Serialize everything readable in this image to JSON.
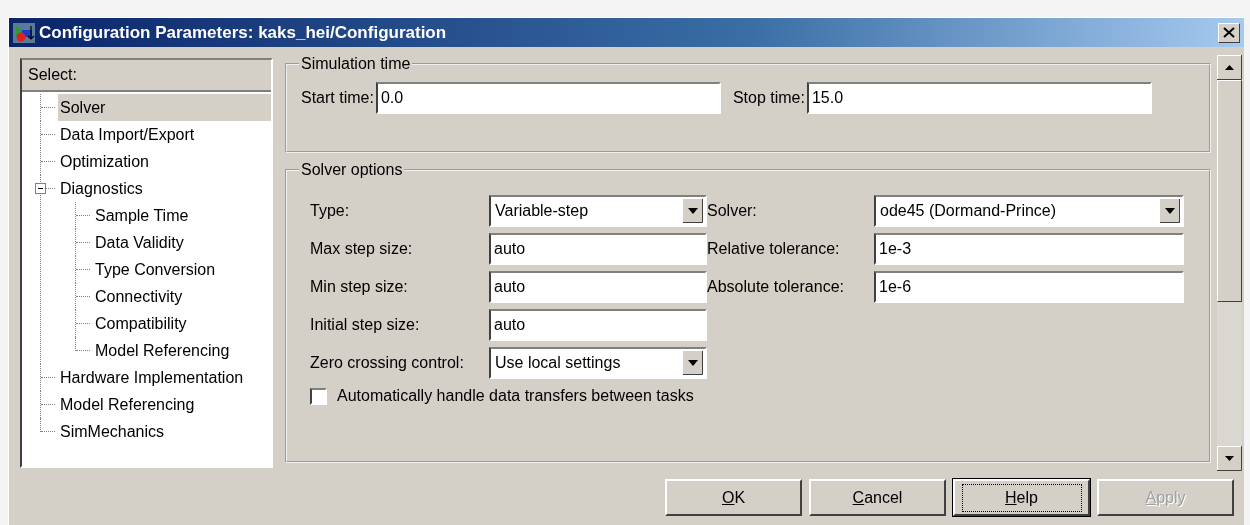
{
  "window": {
    "title": "Configuration Parameters: kaks_hei/Configuration"
  },
  "tree": {
    "header": "Select:",
    "items": [
      {
        "label": "Solver",
        "selected": true
      },
      {
        "label": "Data Import/Export",
        "selected": false
      },
      {
        "label": "Optimization",
        "selected": false
      },
      {
        "label": "Diagnostics",
        "selected": false,
        "expanded": true,
        "children": [
          {
            "label": "Sample Time",
            "selected": false
          },
          {
            "label": "Data Validity",
            "selected": false
          },
          {
            "label": "Type Conversion",
            "selected": false
          },
          {
            "label": "Connectivity",
            "selected": false
          },
          {
            "label": "Compatibility",
            "selected": false
          },
          {
            "label": "Model Referencing",
            "selected": false
          }
        ]
      },
      {
        "label": "Hardware Implementation",
        "selected": false
      },
      {
        "label": "Model Referencing",
        "selected": false
      },
      {
        "label": "SimMechanics",
        "selected": false
      }
    ]
  },
  "simulation_time": {
    "title": "Simulation time",
    "fields": [
      {
        "label": "Start time:",
        "value": "0.0"
      },
      {
        "label": "Stop time:",
        "value": "15.0"
      }
    ]
  },
  "solver_options": {
    "title": "Solver options",
    "rows": [
      {
        "left": {
          "kind": "dropdown",
          "label": "Type:",
          "value": "Variable-step"
        },
        "right": {
          "kind": "dropdown",
          "label": "Solver:",
          "value": "ode45 (Dormand-Prince)"
        }
      },
      {
        "left": {
          "kind": "text",
          "label": "Max step size:",
          "value": "auto"
        },
        "right": {
          "kind": "text",
          "label": "Relative tolerance:",
          "value": "1e-3"
        }
      },
      {
        "left": {
          "kind": "text",
          "label": "Min step size:",
          "value": "auto"
        },
        "right": {
          "kind": "text",
          "label": "Absolute tolerance:",
          "value": "1e-6"
        }
      },
      {
        "left": {
          "kind": "text",
          "label": "Initial step size:",
          "value": "auto"
        }
      },
      {
        "left": {
          "kind": "dropdown",
          "label": "Zero crossing control:",
          "value": "Use local settings"
        }
      }
    ],
    "checkbox": {
      "label": "Automatically handle data transfers between tasks",
      "checked": false
    }
  },
  "buttons": [
    {
      "label": "OK",
      "disabled": false,
      "focused": false
    },
    {
      "label": "Cancel",
      "disabled": false,
      "focused": false
    },
    {
      "label": "Help",
      "disabled": false,
      "focused": true
    },
    {
      "label": "Apply",
      "disabled": true,
      "focused": false
    }
  ]
}
